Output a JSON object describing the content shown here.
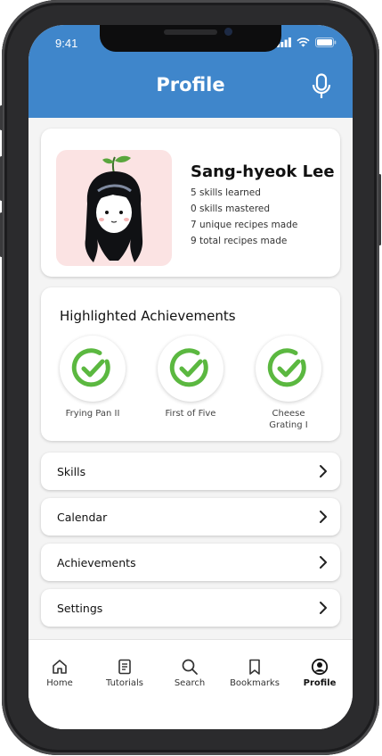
{
  "status_bar": {
    "time": "9:41"
  },
  "header": {
    "title": "Profile",
    "mic_icon": "microphone-icon",
    "color": "#3f86cb"
  },
  "profile": {
    "name": "Sang-hyeok Lee",
    "stats": [
      "5 skills learned",
      "0 skills mastered",
      "7 unique recipes made",
      "9 total recipes made"
    ]
  },
  "achievements": {
    "title": "Highlighted Achievements",
    "items": [
      {
        "label": "Frying Pan II",
        "icon": "check-circle-icon"
      },
      {
        "label": "First of Five",
        "icon": "check-circle-icon"
      },
      {
        "label": "Cheese Grating I",
        "icon": "check-circle-icon"
      }
    ],
    "accent": "#5bb840"
  },
  "menu": [
    {
      "label": "Skills"
    },
    {
      "label": "Calendar"
    },
    {
      "label": "Achievements"
    },
    {
      "label": "Settings"
    }
  ],
  "tabs": [
    {
      "label": "Home",
      "icon": "home-icon"
    },
    {
      "label": "Tutorials",
      "icon": "document-icon"
    },
    {
      "label": "Search",
      "icon": "search-icon"
    },
    {
      "label": "Bookmarks",
      "icon": "bookmark-icon"
    },
    {
      "label": "Profile",
      "icon": "user-circle-icon",
      "active": true
    }
  ]
}
